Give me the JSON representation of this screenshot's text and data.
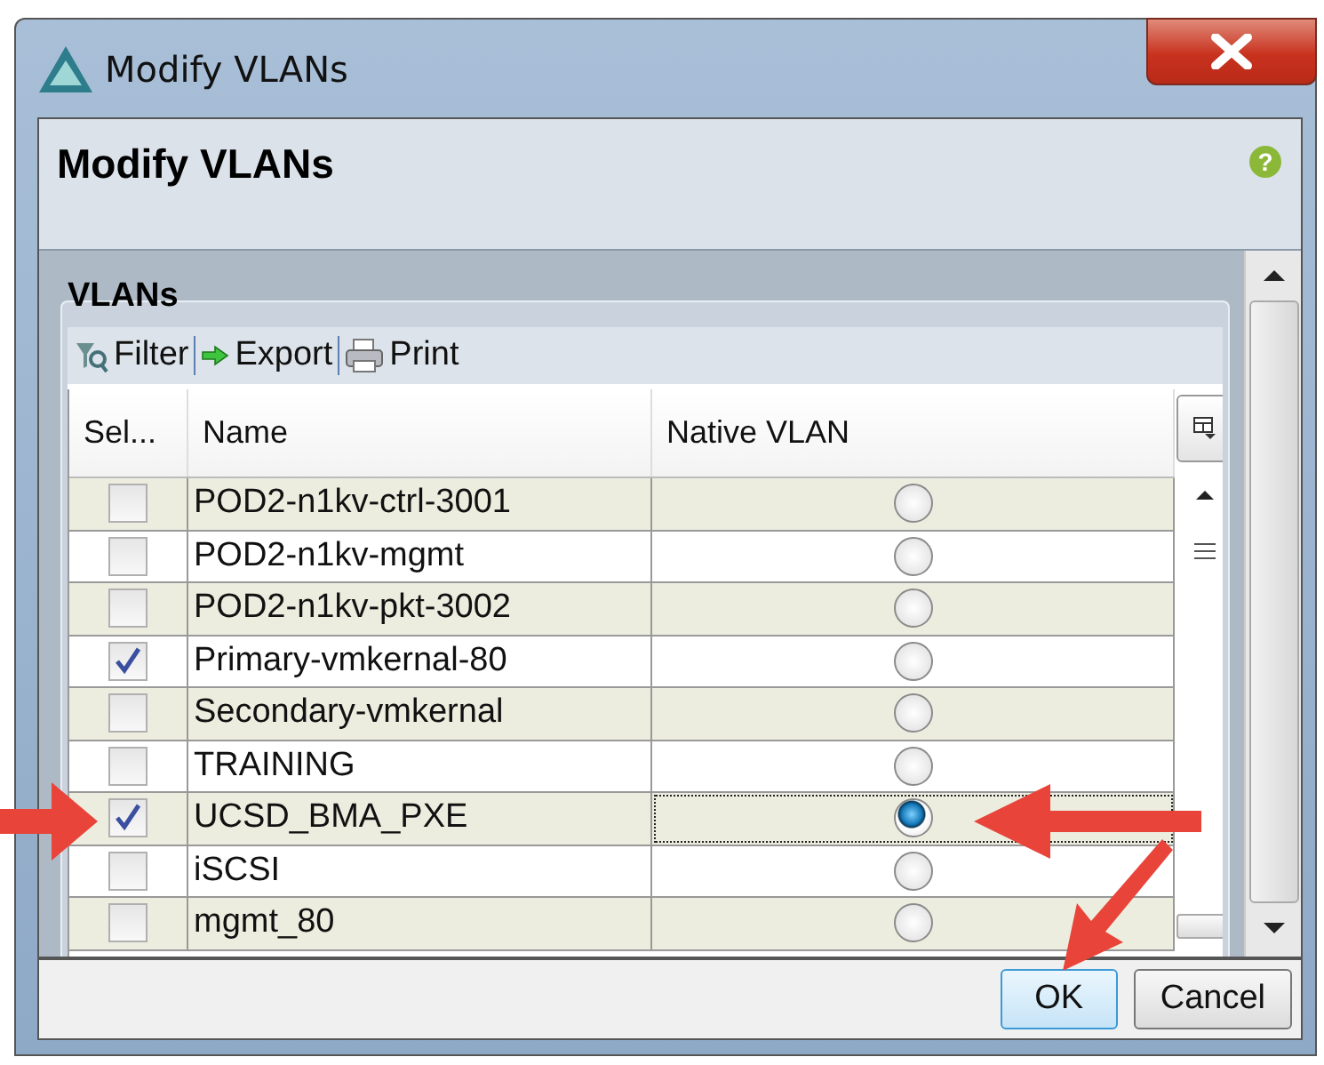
{
  "window": {
    "title": "Modify VLANs"
  },
  "header": {
    "title": "Modify VLANs",
    "help": "?"
  },
  "group": {
    "title": "VLANs"
  },
  "toolbar": [
    {
      "kind": "filter",
      "label": "Filter"
    },
    {
      "kind": "export",
      "label": "Export"
    },
    {
      "kind": "print",
      "label": "Print"
    }
  ],
  "table": {
    "columns": [
      "Sel...",
      "Name",
      "Native VLAN"
    ],
    "rows": [
      {
        "checked": false,
        "name": "POD2-n1kv-ctrl-3001",
        "native": false
      },
      {
        "checked": false,
        "name": "POD2-n1kv-mgmt",
        "native": false
      },
      {
        "checked": false,
        "name": "POD2-n1kv-pkt-3002",
        "native": false
      },
      {
        "checked": true,
        "name": "Primary-vmkernal-80",
        "native": false
      },
      {
        "checked": false,
        "name": "Secondary-vmkernal",
        "native": false
      },
      {
        "checked": false,
        "name": "TRAINING",
        "native": false
      },
      {
        "checked": true,
        "name": "UCSD_BMA_PXE",
        "native": true
      },
      {
        "checked": false,
        "name": "iSCSI",
        "native": false
      },
      {
        "checked": false,
        "name": "mgmt_80",
        "native": false
      }
    ]
  },
  "buttons": [
    {
      "label": "OK",
      "default": true
    },
    {
      "label": "Cancel",
      "default": false
    }
  ]
}
